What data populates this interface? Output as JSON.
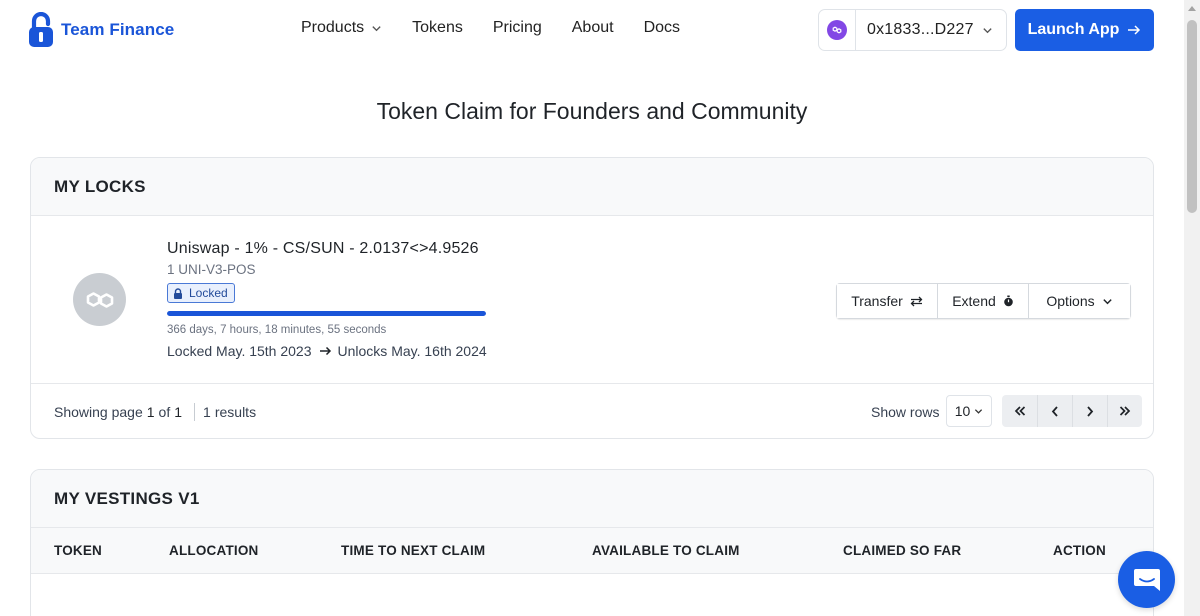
{
  "brand": {
    "name": "Team Finance"
  },
  "nav": {
    "items": [
      {
        "label": "Products",
        "has_dropdown": true
      },
      {
        "label": "Tokens",
        "has_dropdown": false
      },
      {
        "label": "Pricing",
        "has_dropdown": false
      },
      {
        "label": "About",
        "has_dropdown": false
      },
      {
        "label": "Docs",
        "has_dropdown": false
      }
    ]
  },
  "wallet": {
    "address": "0x1833...D227",
    "icon": "polygon-icon"
  },
  "launch_button": {
    "label": "Launch App",
    "icon": "arrow-right-icon"
  },
  "page": {
    "title": "Token Claim for Founders and Community"
  },
  "locks": {
    "heading": "MY LOCKS",
    "items": [
      {
        "name": "Uniswap - 1% - CS/SUN - 2.0137<>4.9526",
        "amount": "1 UNI-V3-POS",
        "status": "Locked",
        "progress": 1.0,
        "countdown": "366 days, 7 hours, 18 minutes, 55 seconds",
        "locked_text": "Locked May. 15th 2023",
        "unlock_text": "Unlocks May. 16th 2024",
        "actions": {
          "transfer": "Transfer",
          "extend": "Extend",
          "options": "Options"
        }
      }
    ],
    "pagination": {
      "showing_prefix": "Showing page",
      "current_page": "1",
      "of_label": "of",
      "total_pages": "1",
      "results_count": "1",
      "results_label": "results",
      "rows_label": "Show rows",
      "rows_value": "10"
    }
  },
  "vestings": {
    "heading": "MY VESTINGS V1",
    "columns": [
      "TOKEN",
      "ALLOCATION",
      "TIME TO NEXT CLAIM",
      "AVAILABLE TO CLAIM",
      "CLAIMED SO FAR",
      "ACTION"
    ]
  },
  "colors": {
    "accent": "#1a5ee4",
    "brand_text": "#1a55d8",
    "badge_bg": "#e9f0fd",
    "badge_border": "#4a79d6",
    "wallet_icon": "#8247e5"
  }
}
